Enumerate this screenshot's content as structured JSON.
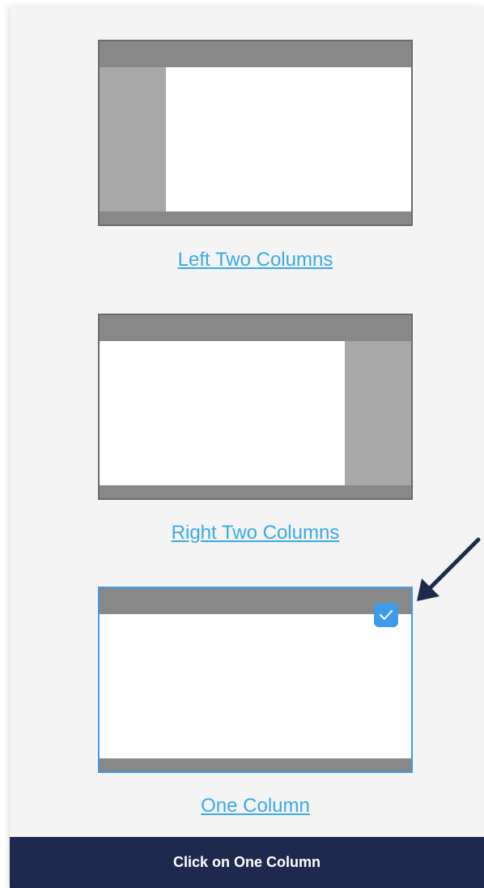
{
  "layouts": [
    {
      "label": "Left Two Columns",
      "sidebar": "left",
      "selected": false
    },
    {
      "label": "Right Two Columns",
      "sidebar": "right",
      "selected": false
    },
    {
      "label": "One Column",
      "sidebar": "none",
      "selected": true
    }
  ],
  "instruction": "Click on One Column",
  "icons": {
    "selected_check": "checkmark-icon",
    "pointer": "arrow-icon"
  },
  "colors": {
    "panel_bg": "#f4f4f4",
    "thumb_bar": "#888888",
    "thumb_sidebar": "#a8a8a8",
    "link": "#3aa8e8",
    "selected_border": "#3d9be9",
    "footer_bg": "#1e2a4d",
    "arrow": "#1e2a4d"
  }
}
